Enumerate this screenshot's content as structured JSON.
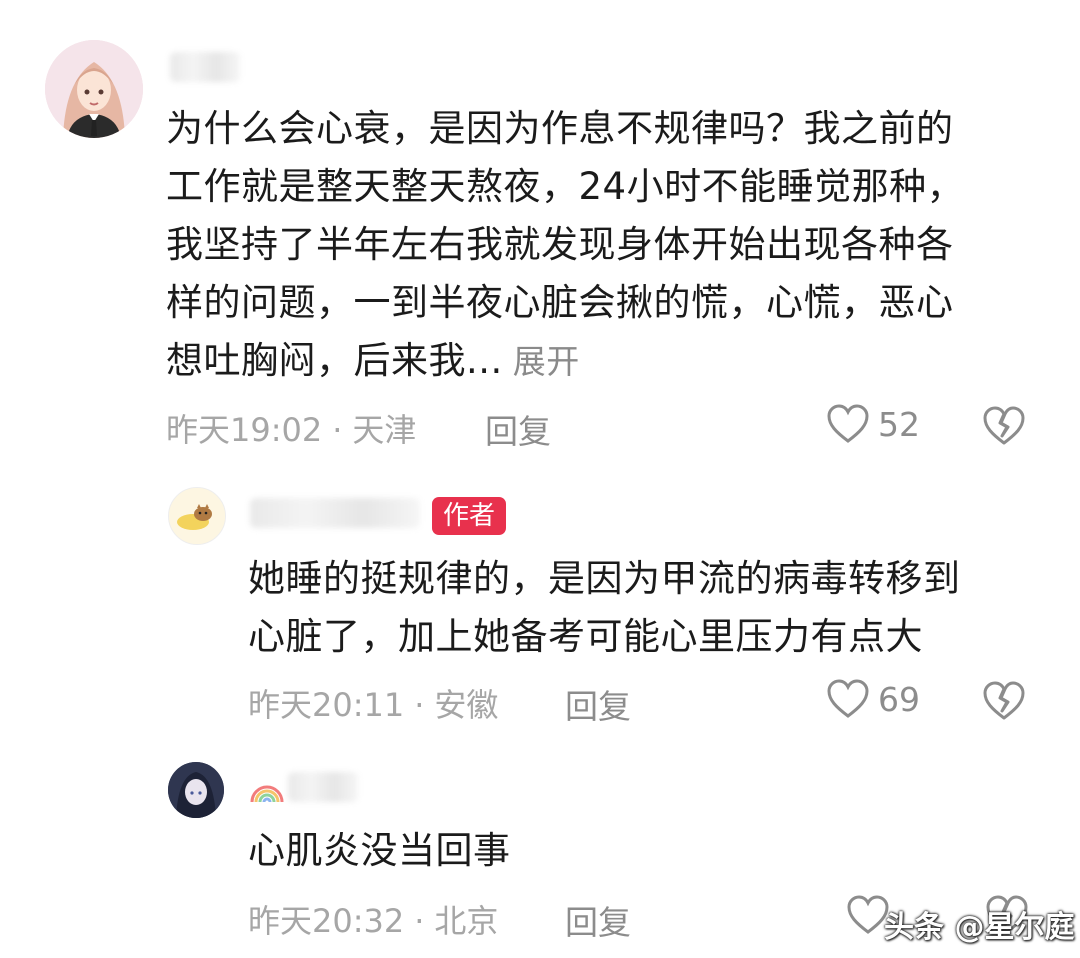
{
  "comments": [
    {
      "lines": [
        "为什么会心衰，是因为作息不规律吗？我之前的",
        "工作就是整天整天熬夜，24小时不能睡觉那种，",
        "我坚持了半年左右我就发现身体开始出现各种各",
        "样的问题，一到半夜心脏会揪的慌，心慌，恶心",
        "想吐胸闷，后来我..."
      ],
      "expand_label": "展开",
      "time": "昨天19:02",
      "location": "天津",
      "reply_label": "回复",
      "likes": "52"
    },
    {
      "badge": "作者",
      "lines": [
        "她睡的挺规律的，是因为甲流的病毒转移到",
        "心脏了，加上她备考可能心里压力有点大"
      ],
      "time": "昨天20:11",
      "location": "安徽",
      "reply_label": "回复",
      "likes": "69"
    },
    {
      "lines": [
        "心肌炎没当回事"
      ],
      "time": "昨天20:32",
      "location": "北京",
      "reply_label": "回复"
    }
  ],
  "separator": "·",
  "watermark": "头条 @星尔庭",
  "colors": {
    "badge": "#e8314d",
    "meta": "#a6a6a6",
    "text": "#1b1b1b"
  }
}
